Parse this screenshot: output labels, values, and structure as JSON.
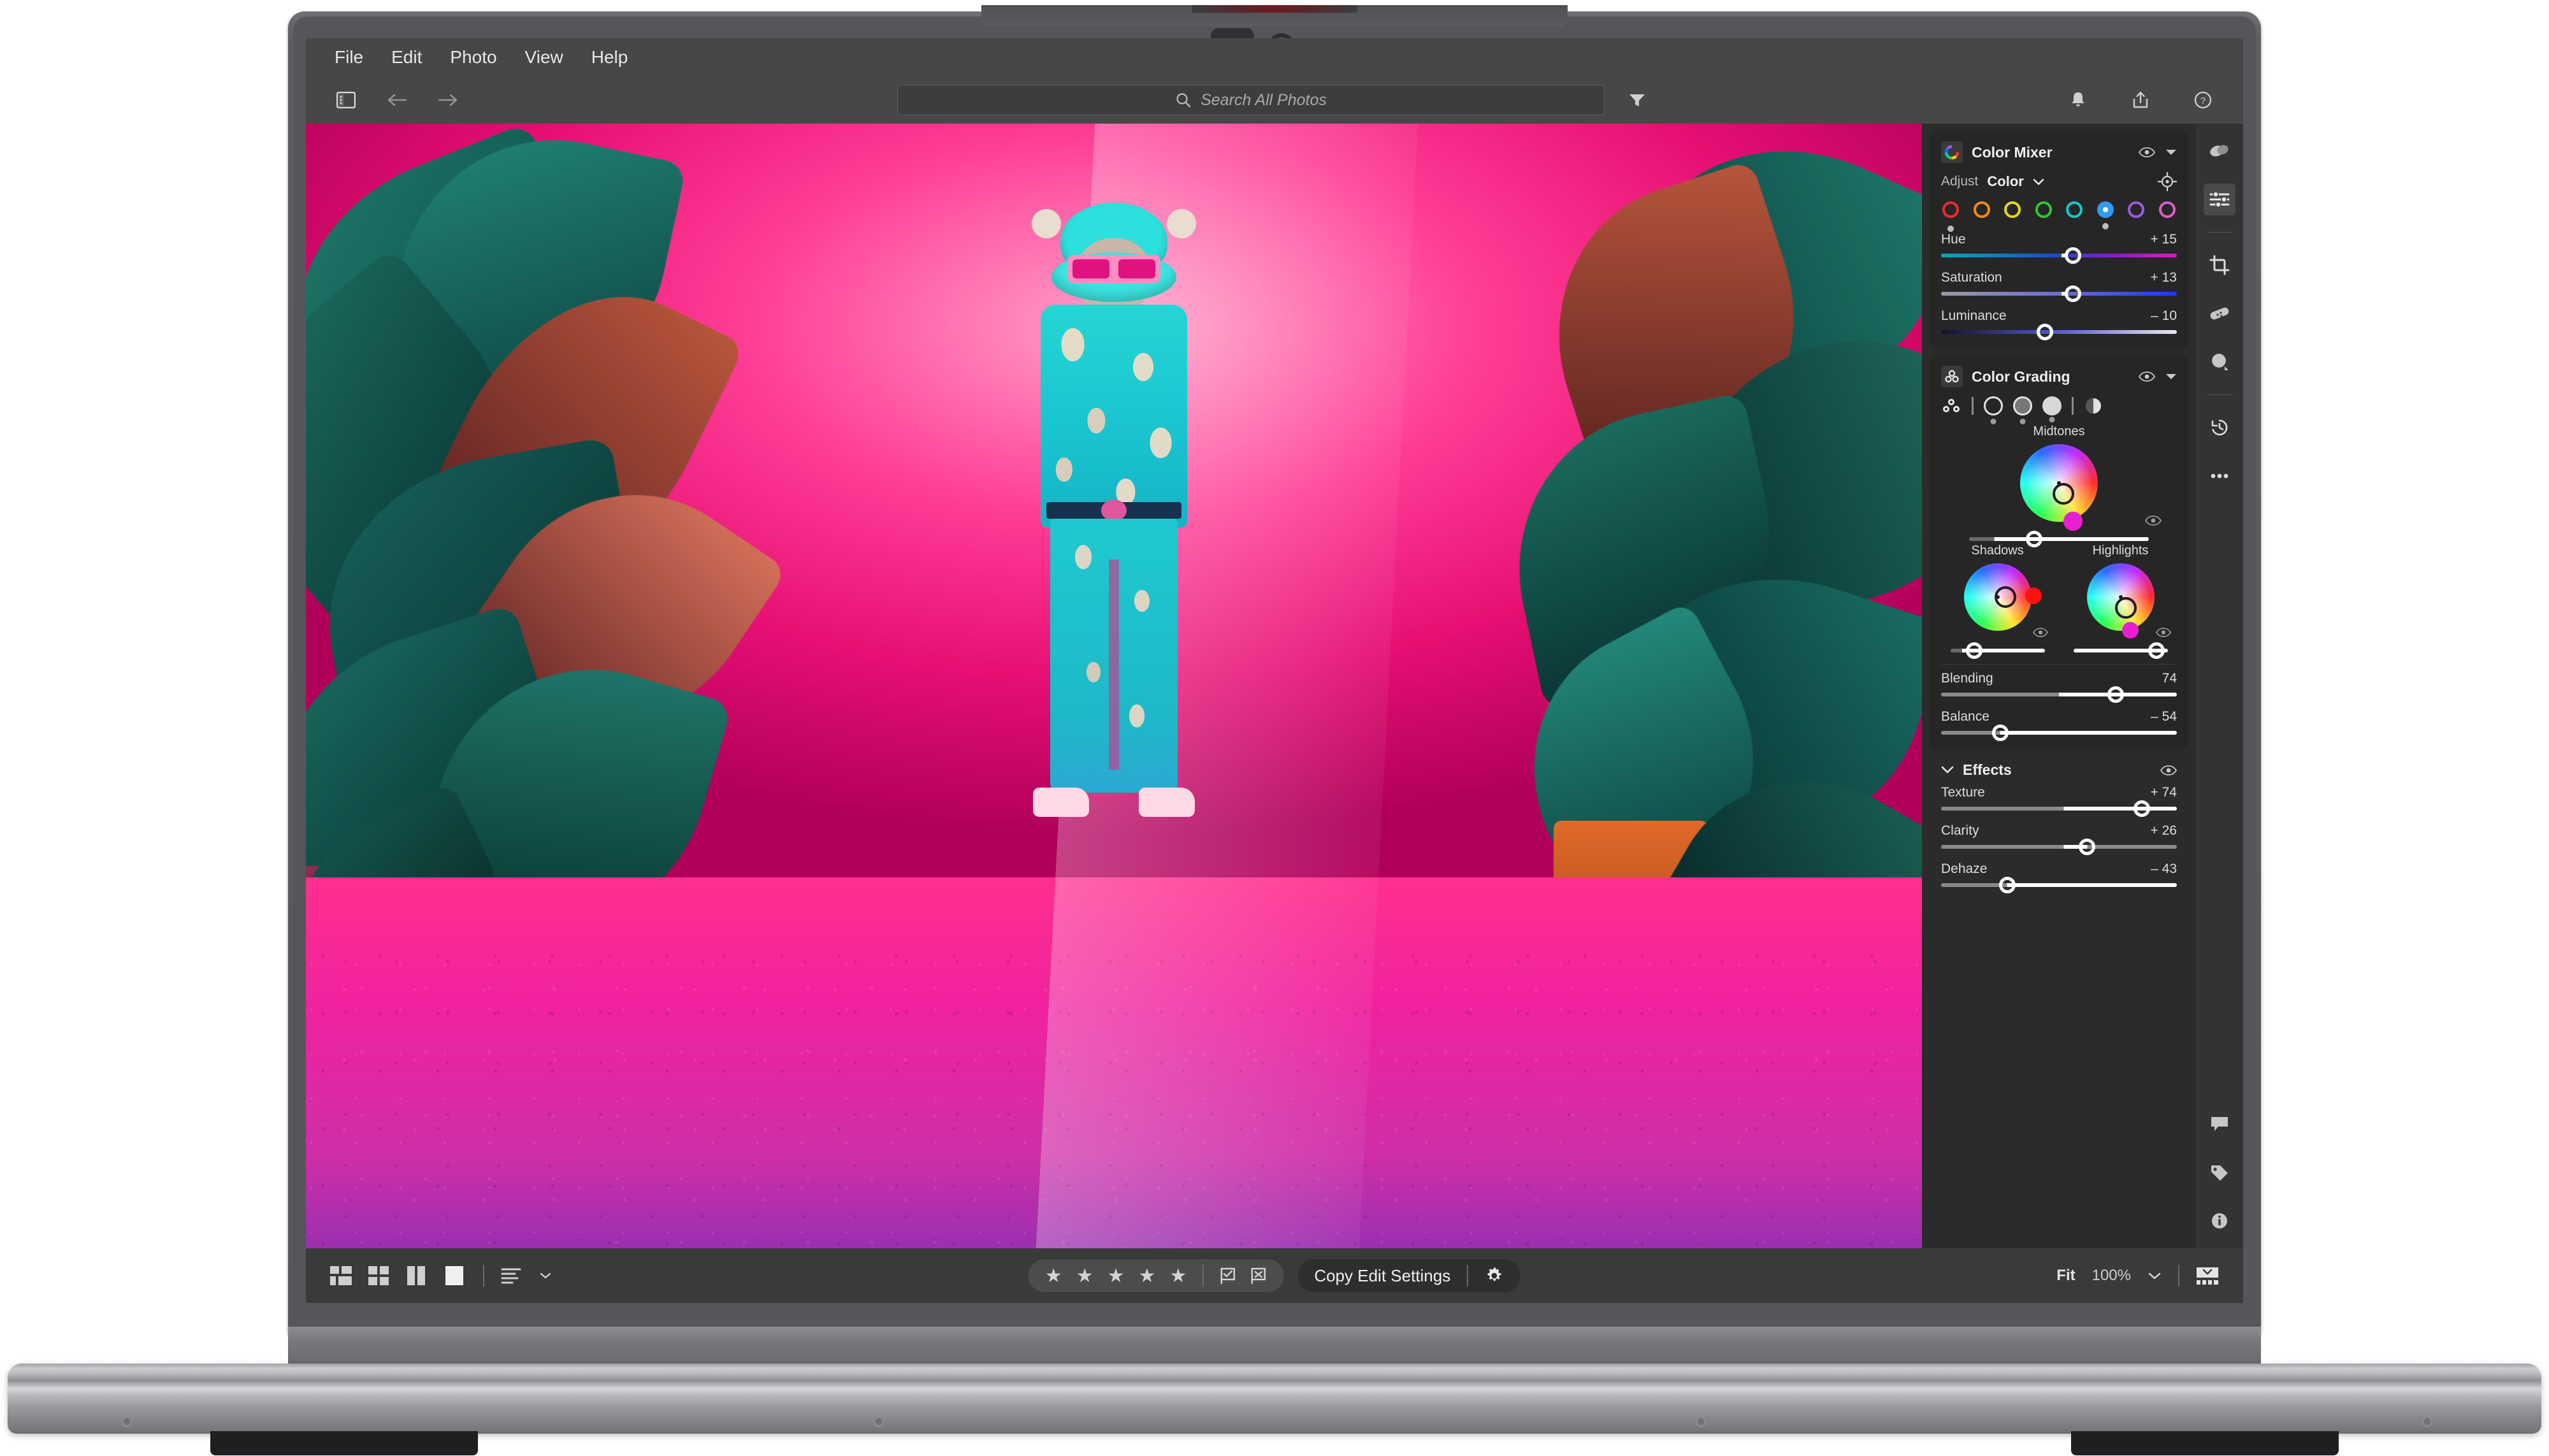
{
  "app": {
    "menu": [
      "File",
      "Edit",
      "Photo",
      "View",
      "Help"
    ]
  },
  "toolbar": {
    "panel_toggle_icon": "left-panel-toggle-icon",
    "back_icon": "arrow-left-icon",
    "forward_icon": "arrow-right-icon",
    "search": {
      "placeholder": "Search All Photos",
      "value": "",
      "icon": "search-icon"
    },
    "filter_icon": "filter-funnel-icon",
    "notifications_icon": "bell-icon",
    "share_icon": "share-icon",
    "help_icon": "help-circle-icon"
  },
  "color_mixer": {
    "title": "Color Mixer",
    "badge_icon": "color-wheel-icon",
    "visibility_icon": "eye-icon",
    "collapse_icon": "chevron-down-icon",
    "target_icon": "target-adjust-icon",
    "adjust_label": "Adjust",
    "adjust_value": "Color",
    "adjust_chevron": "chevron-down-icon",
    "swatches": [
      {
        "name": "red",
        "color": "#ef2b2b",
        "selected": false,
        "modified": true
      },
      {
        "name": "orange",
        "color": "#f08a15",
        "selected": false,
        "modified": false
      },
      {
        "name": "yellow",
        "color": "#e3d916",
        "selected": false,
        "modified": false
      },
      {
        "name": "green",
        "color": "#2fc82f",
        "selected": false,
        "modified": false
      },
      {
        "name": "aqua",
        "color": "#16c9c9",
        "selected": false,
        "modified": false
      },
      {
        "name": "blue",
        "color": "#2f9bf5",
        "selected": true,
        "modified": true
      },
      {
        "name": "purple",
        "color": "#9b5ce0",
        "selected": false,
        "modified": false
      },
      {
        "name": "magenta",
        "color": "#e05ccf",
        "selected": false,
        "modified": false
      }
    ],
    "sliders": [
      {
        "name": "Hue",
        "value": "+ 15",
        "pos": 56
      },
      {
        "name": "Saturation",
        "value": "+ 13",
        "pos": 56
      },
      {
        "name": "Luminance",
        "value": "– 10",
        "pos": 44
      }
    ]
  },
  "color_grading": {
    "title": "Color Grading",
    "badge_icon": "three-circles-icon",
    "visibility_icon": "eye-icon",
    "collapse_icon": "chevron-down-icon",
    "tabs": [
      {
        "name": "all-wheels",
        "icon": "three-circles-icon"
      },
      {
        "name": "shadows",
        "icon": "circle-outline-icon"
      },
      {
        "name": "midtones",
        "icon": "circle-half-fill-icon"
      },
      {
        "name": "highlights",
        "icon": "circle-filled-icon"
      },
      {
        "name": "global",
        "icon": "circle-contrast-icon"
      }
    ],
    "midtones": {
      "label": "Midtones",
      "luminance_pos": 36,
      "eye_icon": "eye-icon"
    },
    "shadows": {
      "label": "Shadows",
      "luminance_pos": 25,
      "eye_icon": "eye-icon"
    },
    "highlights": {
      "label": "Highlights",
      "luminance_pos": 88,
      "eye_icon": "eye-icon"
    },
    "sliders": [
      {
        "name": "Blending",
        "value": "74",
        "pos": 74
      },
      {
        "name": "Balance",
        "value": "– 54",
        "pos": 25
      }
    ]
  },
  "effects": {
    "title": "Effects",
    "collapse_icon": "chevron-down-icon",
    "visibility_icon": "eye-icon",
    "sliders": [
      {
        "name": "Texture",
        "value": "+ 74",
        "pos": 85
      },
      {
        "name": "Clarity",
        "value": "+ 26",
        "pos": 62
      },
      {
        "name": "Dehaze",
        "value": "– 43",
        "pos": 28
      }
    ]
  },
  "rail": {
    "items": [
      {
        "name": "presets-icon",
        "active": false
      },
      {
        "name": "edit-sliders-icon",
        "active": true
      },
      {
        "name": "crop-icon",
        "active": false
      },
      {
        "name": "healing-brush-icon",
        "active": false
      },
      {
        "name": "masking-icon",
        "active": false
      },
      {
        "name": "history-icon",
        "active": false
      },
      {
        "name": "more-options-icon",
        "active": false
      }
    ],
    "bottom_items": [
      {
        "name": "comments-icon"
      },
      {
        "name": "keywords-tag-icon"
      },
      {
        "name": "info-icon"
      }
    ]
  },
  "bottombar": {
    "view_modes": [
      {
        "name": "grid-view-icon"
      },
      {
        "name": "square-grid-view-icon"
      },
      {
        "name": "compare-view-icon"
      },
      {
        "name": "detail-view-icon"
      }
    ],
    "sort_icon": "sort-icon",
    "sort_chevron": "chevron-down-icon",
    "rating": {
      "stars": 5,
      "value": 0
    },
    "flag_icon": "flag-pick-icon",
    "reject_icon": "flag-reject-icon",
    "copy_button": "Copy Edit Settings",
    "settings_icon": "gear-icon",
    "zoom_label": "Fit",
    "zoom_value": "100%",
    "zoom_chevron": "chevron-down-icon",
    "filmstrip_icon": "filmstrip-toggle-icon"
  },
  "photo": {
    "description": "neon-lit portrait of a figure in teal patterned suit with fuzzy bear hat and pink sunglasses among tropical plants",
    "accent_magenta": "#ff2f8d",
    "accent_teal": "#1fc9cf"
  }
}
